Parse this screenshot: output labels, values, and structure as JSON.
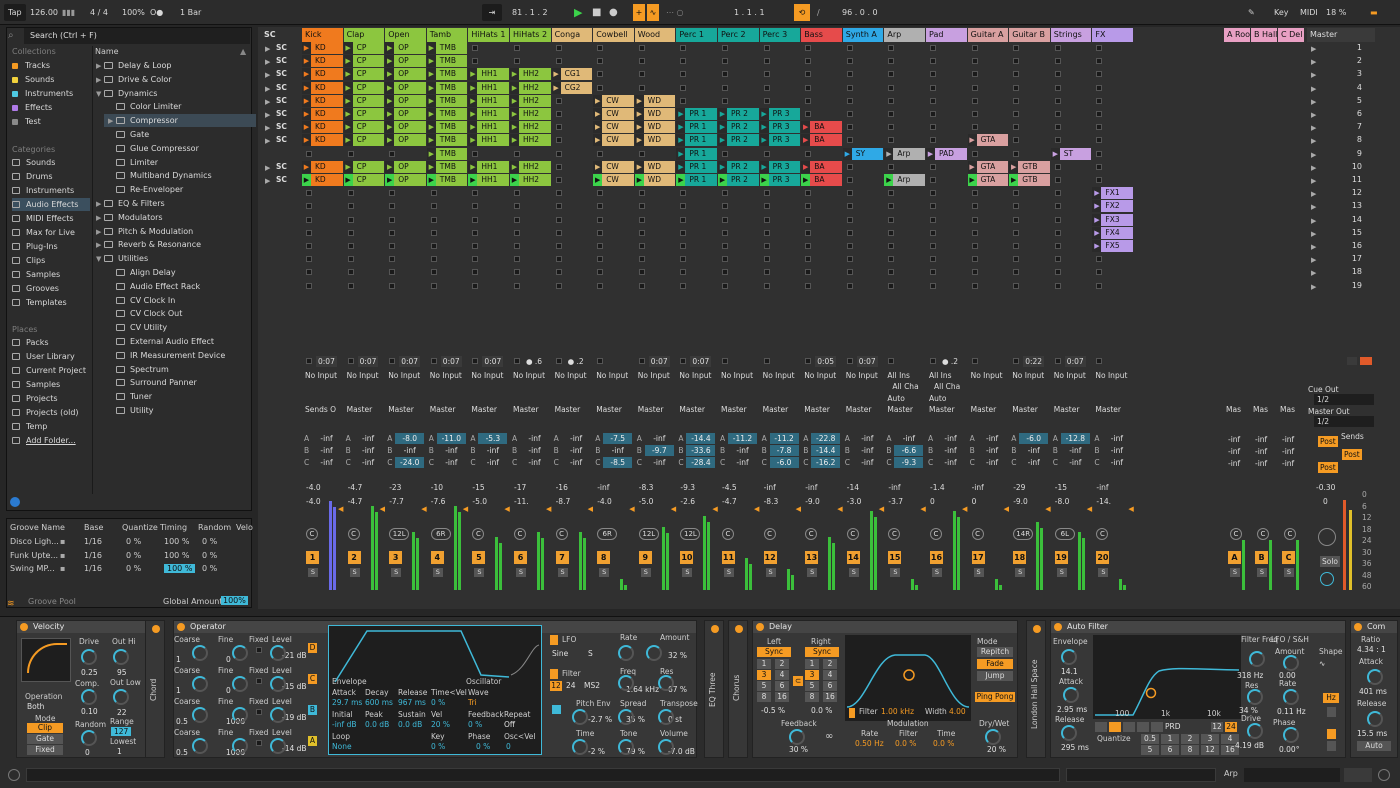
{
  "transport": {
    "tap": "Tap",
    "tempo": "126.00",
    "signature": "4 / 4",
    "zoom": "100%",
    "metronome": "O●",
    "quantize": "1 Bar",
    "position": "81 .   1 .   2",
    "loop_start": "1 .   1 .   1",
    "loop_length": "96 .   0 .   0",
    "key": "Key",
    "midi": "MIDI",
    "cpu": "18 %"
  },
  "browser": {
    "search": "Search (Ctrl + F)",
    "collections_label": "Collections",
    "collections": [
      {
        "label": "Tracks",
        "color": "#f59b23"
      },
      {
        "label": "Sounds",
        "color": "#f2d13c"
      },
      {
        "label": "Instruments",
        "color": "#4ec9e2"
      },
      {
        "label": "Effects",
        "color": "#b07be8"
      },
      {
        "label": "Test",
        "color": "#8a8a8a"
      }
    ],
    "categories_label": "Categories",
    "categories": [
      "Sounds",
      "Drums",
      "Instruments",
      "Audio Effects",
      "MIDI Effects",
      "Max for Live",
      "Plug-Ins",
      "Clips",
      "Samples",
      "Grooves",
      "Templates"
    ],
    "places_label": "Places",
    "places": [
      "Packs",
      "User Library",
      "Current Project",
      "Samples",
      "Projects",
      "Projects (old)",
      "Temp",
      "Add Folder..."
    ],
    "name_header": "Name",
    "items": [
      "Delay & Loop",
      "Drive & Color",
      "Dynamics",
      "Color Limiter",
      "Compressor",
      "Gate",
      "Glue Compressor",
      "Limiter",
      "Multiband Dynamics",
      "Re-Enveloper",
      "EQ & Filters",
      "Modulators",
      "Pitch & Modulation",
      "Reverb & Resonance",
      "Utilities",
      "Align Delay",
      "Audio Effect Rack",
      "CV Clock In",
      "CV Clock Out",
      "CV Utility",
      "External Audio Effect",
      "IR Measurement Device",
      "Spectrum",
      "Surround Panner",
      "Tuner",
      "Utility"
    ]
  },
  "groove": {
    "headers": [
      "Groove Name",
      "Base",
      "Quantize",
      "Timing",
      "Random",
      "Velo"
    ],
    "rows": [
      [
        "Disco Ligh...",
        "1/16",
        "0 %",
        "100 %",
        "0 %"
      ],
      [
        "Funk Upte...",
        "1/16",
        "0 %",
        "100 %",
        "0 %"
      ],
      [
        "Swing MP...",
        "1/16",
        "0 %",
        "100 %",
        "0 %"
      ]
    ],
    "pool": "Groove Pool",
    "global_amount_label": "Global Amount",
    "global_amount": "100%"
  },
  "session": {
    "sc": "SC",
    "tracks": [
      {
        "name": "Kick",
        "color": "#f07a1e"
      },
      {
        "name": "Clap",
        "color": "#8cc63f"
      },
      {
        "name": "Open",
        "color": "#8cc63f"
      },
      {
        "name": "Tamb",
        "color": "#8cc63f"
      },
      {
        "name": "HiHats 1",
        "color": "#8cc63f"
      },
      {
        "name": "HiHats 2",
        "color": "#8cc63f"
      },
      {
        "name": "Conga",
        "color": "#e0b978"
      },
      {
        "name": "Cowbell",
        "color": "#e0b978"
      },
      {
        "name": "Wood",
        "color": "#e0b978"
      },
      {
        "name": "Perc 1",
        "color": "#17a89a"
      },
      {
        "name": "Perc 2",
        "color": "#17a89a"
      },
      {
        "name": "Perc 3",
        "color": "#17a89a"
      },
      {
        "name": "Bass",
        "color": "#e64b4b"
      },
      {
        "name": "Synth A",
        "color": "#2fa9e6"
      },
      {
        "name": "Arp",
        "color": "#b0b0b0"
      },
      {
        "name": "Pad",
        "color": "#c8a0e0"
      },
      {
        "name": "Guitar A",
        "color": "#d9a0a0"
      },
      {
        "name": "Guitar B",
        "color": "#d9a0a0"
      },
      {
        "name": "Strings",
        "color": "#c8a0e0"
      },
      {
        "name": "FX",
        "color": "#b89ae8"
      }
    ],
    "returns": [
      {
        "name": "A Roo",
        "color": "#e9a0c4"
      },
      {
        "name": "B Hall",
        "color": "#e9a0c4"
      },
      {
        "name": "C Del",
        "color": "#e9a0c4"
      }
    ],
    "master": "Master",
    "scenes": [
      "1",
      "2",
      "3",
      "4",
      "5",
      "6",
      "7",
      "8",
      "9",
      "10",
      "11",
      "12",
      "13",
      "14",
      "15",
      "16",
      "17",
      "18",
      "19"
    ],
    "clip_names": {
      "kick": "KD",
      "clap": "CP",
      "open": "OP",
      "tamb": "TMB",
      "hh1": "HH1",
      "hh2": "HH2",
      "conga1": "CG1",
      "conga2": "CG2",
      "cow": "CW",
      "wood": "WD",
      "p1": "PR 1",
      "p2": "PR 2",
      "p3": "PR 3",
      "bass": "BA",
      "sy": "SY",
      "arp": "Arp",
      "pad": "PAD",
      "gta": "GTA",
      "gtb": "GTB",
      "st": "ST",
      "fx": [
        "FX1",
        "FX2",
        "FX3",
        "FX4",
        "FX5"
      ]
    },
    "times": [
      "0:07",
      "0:07",
      "0:07",
      "0:07",
      "0:07",
      "● .6",
      "● .2",
      "",
      "0:07",
      "0:07",
      "",
      "",
      "0:05",
      "0:07",
      "",
      "● .2",
      "",
      "0:22",
      "0:07",
      ""
    ],
    "io_in": "No Input",
    "io_out": "Master",
    "sends_only": "Sends O",
    "all_ins": "All Ins",
    "all_ch": "All Cha",
    "auto": "Auto",
    "cue_out": "Cue Out",
    "cue_val": "1/2",
    "master_out": "Master Out",
    "master_val": "1/2",
    "sends_label": "Sends",
    "post": "Post",
    "send_a": [
      "-inf",
      "-inf",
      "-8.0",
      "-11.0",
      "-5.3",
      "-inf",
      "-inf",
      "-7.5",
      "-inf",
      "-14.4",
      "-11.2",
      "-11.2",
      "-22.8",
      "-inf",
      "-inf",
      "-inf",
      "-inf",
      "-6.0",
      "-12.8",
      "-inf",
      "-inf"
    ],
    "send_b": [
      "-inf",
      "-inf",
      "-inf",
      "-inf",
      "-inf",
      "-inf",
      "-inf",
      "-inf",
      "-9.7",
      "-33.6",
      "-inf",
      "-7.8",
      "-14.4",
      "-inf",
      "-6.6",
      "-inf",
      "-inf",
      "-inf",
      "-inf",
      "-inf",
      "-inf"
    ],
    "send_c": [
      "-inf",
      "-inf",
      "-24.0",
      "-inf",
      "-inf",
      "-inf",
      "-inf",
      "-8.5",
      "-inf",
      "-28.4",
      "-inf",
      "-6.0",
      "-16.2",
      "-inf",
      "-9.3",
      "-inf",
      "-inf",
      "-inf",
      "-inf",
      "-inf",
      "-inf"
    ],
    "vol1": [
      "-4.0",
      "-4.7",
      "-23",
      "-10",
      "-15",
      "-17",
      "-16",
      "-inf",
      "-8.3",
      "-9.3",
      "-4.5",
      "-inf",
      "-inf",
      "-14",
      "-inf",
      "-1.4",
      "-inf",
      "-29",
      "-15",
      "-inf",
      "-inf"
    ],
    "vol2": [
      "-4.0",
      "-4.7",
      "-7.7",
      "-7.6",
      "-5.0",
      "-11.",
      "-8.7",
      "-4.0",
      "-5.0",
      "-2.6",
      "-4.7",
      "-8.3",
      "-9.0",
      "-3.0",
      "-3.7",
      "0",
      "0",
      "-9.0",
      "-8.0",
      "-14.",
      "-6.1"
    ],
    "pans": [
      "C",
      "C",
      "12L",
      "6R",
      "C",
      "C",
      "C",
      "6R",
      "12L",
      "12L",
      "C",
      "C",
      "C",
      "C",
      "C",
      "C",
      "C",
      "14R",
      "6L",
      "C",
      "C"
    ],
    "master_vol": "-0.30",
    "master_vol2": "0",
    "ticks": [
      "0",
      "6",
      "12",
      "18",
      "24",
      "30",
      "36",
      "48",
      "60"
    ],
    "solo": "Solo"
  },
  "devices": {
    "velocity": {
      "title": "Velocity",
      "drive": "Drive",
      "drive_val": "0.25",
      "comp": "Comp.",
      "comp_val": "0.10",
      "out_hi": "Out Hi",
      "out_hi_val": "95",
      "out_low": "Out Low",
      "out_low_val": "22",
      "range": "Range",
      "range_val": "127",
      "lowest": "Lowest",
      "lowest_val": "1",
      "random": "Random",
      "random_val": "0",
      "operation": "Operation",
      "operation_val": "Both",
      "mode": "Mode",
      "modes": [
        "Clip",
        "Gate",
        "Fixed"
      ]
    },
    "operator": {
      "title": "Operator",
      "rows": [
        {
          "coarse": "1",
          "fine": "0",
          "level": "-21 dB",
          "letter": "D"
        },
        {
          "coarse": "1",
          "fine": "0",
          "level": "-15 dB",
          "letter": "C"
        },
        {
          "coarse": "0.5",
          "fine": "1000",
          "level": "-19 dB",
          "letter": "B"
        },
        {
          "coarse": "0.5",
          "fine": "1000",
          "level": "-14 dB",
          "letter": "A"
        }
      ],
      "coarse": "Coarse",
      "fine": "Fine",
      "fixed": "Fixed",
      "level": "Level",
      "envelope": "Envelope",
      "oscillator": "Oscillator",
      "env_labels": [
        "Attack",
        "Decay",
        "Release",
        "Time<Vel"
      ],
      "env_vals": [
        "29.7 ms",
        "600 ms",
        "967 ms",
        "0 %"
      ],
      "init_labels": [
        "Initial",
        "Peak",
        "Sustain",
        "Vel"
      ],
      "init_vals": [
        "-inf dB",
        "0.0 dB",
        "0.0 dB",
        "20 %"
      ],
      "loop": "Loop",
      "loop_val": "None",
      "key": "Key",
      "key_val": "0 %",
      "wave": "Wave",
      "wave_val": "Tri",
      "feedback": "Feedback",
      "feedback_val": "0 %",
      "repeat": "Repeat",
      "repeat_val": "Off",
      "phase": "Phase",
      "phase_val": "0 %",
      "osc_vel": "Osc<Vel",
      "osc_vel_val": "0",
      "lfo": "LFO",
      "lfo_shape": "Sine",
      "lfo_s": "S",
      "rate": "Rate",
      "amount": "Amount",
      "amount_val": "32 %",
      "filter": "Filter",
      "f12": "12",
      "f24": "24",
      "ms2": "MS2",
      "freq": "Freq",
      "freq_val": "1.64 kHz",
      "res": "Res",
      "res_val": "67 %",
      "pitch_env": "Pitch Env",
      "pitch_env_val": "-2.7 %",
      "spread": "Spread",
      "spread_val": "35 %",
      "transpose": "Transpose",
      "transpose_val": "0 st",
      "time": "Time",
      "time_val": "-2 %",
      "tone": "Tone",
      "tone_val": "79 %",
      "volume": "Volume",
      "volume_val": "-7.0 dB"
    },
    "chorus": "Chorus",
    "eq_three": "EQ Three",
    "delay": {
      "title": "Delay",
      "left": "Left",
      "right": "Right",
      "sync": "Sync",
      "grid_left": [
        "1",
        "2",
        "3",
        "4",
        "5",
        "6",
        "8",
        "16"
      ],
      "grid_right": [
        "1",
        "2",
        "3",
        "4",
        "5",
        "6",
        "8",
        "16"
      ],
      "offset_l": "-0.5 %",
      "offset_r": "0.0 %",
      "mode": "Mode",
      "modes": [
        "Repitch",
        "Fade",
        "Jump"
      ],
      "ping_pong": "Ping Pong",
      "feedback": "Feedback",
      "feedback_val": "30 %",
      "filter": "Filter",
      "filter_val": "1.00 kHz",
      "width": "Width",
      "width_val": "4.00",
      "modulation": "Modulation",
      "rate": "Rate",
      "rate_val": "0.50 Hz",
      "filter2": "Filter",
      "filter2_val": "0.0 %",
      "time": "Time",
      "time_val": "0.0 %",
      "dry_wet": "Dry/Wet",
      "dry_wet_val": "20 %"
    },
    "london": "London Hall Space",
    "auto_filter": {
      "title": "Auto Filter",
      "envelope": "Envelope",
      "amount_val": "14.1",
      "attack": "Attack",
      "attack_val": "2.95 ms",
      "release": "Release",
      "release_val": "295 ms",
      "freq_ticks": [
        "100",
        "1k",
        "10k"
      ],
      "prd": "PRD",
      "n12": "12",
      "n24": "24",
      "quantize": "Quantize",
      "q_vals": [
        "0.5",
        "1",
        "2",
        "3",
        "4",
        "5",
        "6",
        "8",
        "12",
        "16"
      ],
      "filter_freq": "Filter Freq",
      "filter_freq_val": "318 Hz",
      "res": "Res",
      "res_val": "34 %",
      "drive": "Drive",
      "drive_val": "4.19 dB",
      "lfo_sh": "LFO / S&H",
      "amount": "Amount",
      "amount_val2": "0.00",
      "rate": "Rate",
      "rate_val": "0.11 Hz",
      "phase": "Phase",
      "phase_val": "0.00°",
      "shape": "Shape",
      "hz": "Hz"
    },
    "comp": {
      "title": "Com",
      "ratio": "Ratio",
      "ratio_val": "4.34 : 1",
      "attack": "Attack",
      "attack_val": "401 ms",
      "release": "Release",
      "release_val": "15.5 ms",
      "auto": "Auto"
    }
  },
  "status": {
    "arp": "Arp"
  }
}
